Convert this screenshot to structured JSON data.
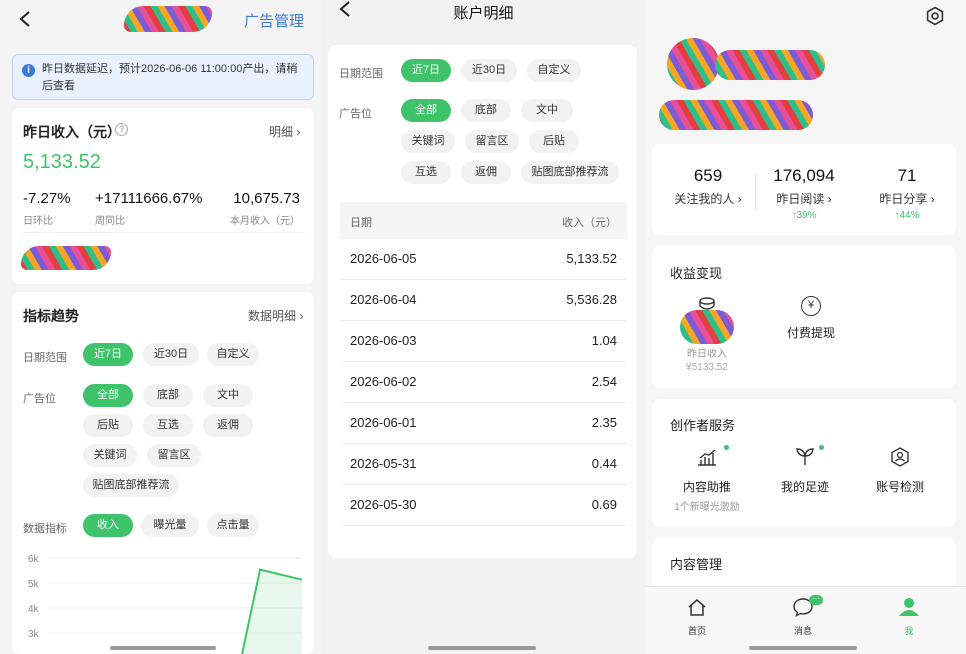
{
  "panel1": {
    "header_title": "广告管理",
    "notice": "昨日数据延迟，预计2026-06-06 11:00:00产出，请稍后查看",
    "income": {
      "title": "昨日收入（元）",
      "detail_link": "明细",
      "value": "5,133.52",
      "stats": [
        {
          "value": "-7.27%",
          "label": "日环比"
        },
        {
          "value": "+17111666.67%",
          "label": "周同比"
        },
        {
          "value": "10,675.73",
          "label": "本月收入（元）"
        }
      ]
    },
    "trend": {
      "title": "指标趋势",
      "detail_link": "数据明细",
      "date_label": "日期范围",
      "date_chips": [
        "近7日",
        "近30日",
        "自定义"
      ],
      "ad_label": "广告位",
      "ad_chips": [
        "全部",
        "底部",
        "文中",
        "后贴",
        "互选",
        "返佣",
        "关键词",
        "留言区",
        "贴图底部推荐流"
      ],
      "metric_label": "数据指标",
      "metric_chips": [
        "收入",
        "曝光量",
        "点击量"
      ]
    }
  },
  "chart_data": {
    "type": "area",
    "y_ticks": [
      "6k",
      "5k",
      "4k",
      "3k"
    ],
    "ylim": [
      3000,
      6000
    ],
    "values": [
      5536.28,
      5133.52
    ],
    "color": "#3ec36b"
  },
  "panel2": {
    "header_title": "账户明细",
    "date_label": "日期范围",
    "date_chips": [
      "近7日",
      "近30日",
      "自定义"
    ],
    "ad_label": "广告位",
    "ad_chips": [
      "全部",
      "底部",
      "文中",
      "关键词",
      "留言区",
      "后贴",
      "互选",
      "返佣",
      "贴图底部推荐流"
    ],
    "table": {
      "col_date": "日期",
      "col_income": "收入（元）",
      "rows": [
        {
          "date": "2026-06-05",
          "income": "5,133.52"
        },
        {
          "date": "2026-06-04",
          "income": "5,536.28"
        },
        {
          "date": "2026-06-03",
          "income": "1.04"
        },
        {
          "date": "2026-06-02",
          "income": "2.54"
        },
        {
          "date": "2026-06-01",
          "income": "2.35"
        },
        {
          "date": "2026-05-31",
          "income": "0.44"
        },
        {
          "date": "2026-05-30",
          "income": "0.69"
        }
      ]
    }
  },
  "panel3": {
    "stats": [
      {
        "value": "659",
        "label": "关注我的人",
        "growth": ""
      },
      {
        "value": "176,094",
        "label": "昨日阅读",
        "growth": "↑39%"
      },
      {
        "value": "71",
        "label": "昨日分享",
        "growth": "↑44%"
      }
    ],
    "monetize": {
      "title": "收益变现",
      "yesterday_label": "昨日收入",
      "yesterday_value": "¥5133.52",
      "withdraw_label": "付费提现"
    },
    "creator": {
      "title": "创作者服务",
      "items": [
        {
          "label": "内容助推",
          "sub": "1个新曝光激励"
        },
        {
          "label": "我的足迹",
          "sub": ""
        },
        {
          "label": "账号检测",
          "sub": ""
        }
      ]
    },
    "content_title": "内容管理",
    "tabs": [
      {
        "label": "首页"
      },
      {
        "label": "消息"
      },
      {
        "label": "我"
      }
    ]
  }
}
